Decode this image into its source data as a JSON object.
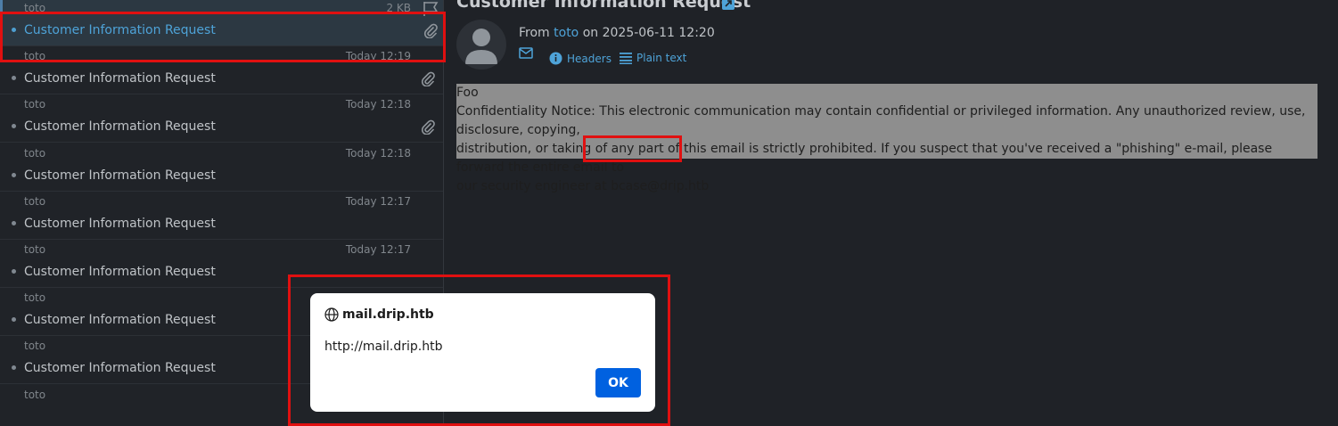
{
  "message_list": {
    "rows": [
      {
        "from": "toto",
        "date": "2 KB",
        "subject": "Customer Information Request",
        "attachment": true,
        "flag": true,
        "selected": true
      },
      {
        "from": "toto",
        "date": "Today 12:19",
        "subject": "Customer Information Request",
        "attachment": true
      },
      {
        "from": "toto",
        "date": "Today 12:18",
        "subject": "Customer Information Request",
        "attachment": true
      },
      {
        "from": "toto",
        "date": "Today 12:18",
        "subject": "Customer Information Request",
        "attachment": false
      },
      {
        "from": "toto",
        "date": "Today 12:17",
        "subject": "Customer Information Request",
        "attachment": false
      },
      {
        "from": "toto",
        "date": "Today 12:17",
        "subject": "Customer Information Request",
        "attachment": false
      },
      {
        "from": "toto",
        "date": "",
        "subject": "Customer Information Request",
        "attachment": false
      },
      {
        "from": "toto",
        "date": "",
        "subject": "Customer Information Request",
        "attachment": false
      },
      {
        "from": "toto",
        "date": "",
        "subject": "",
        "attachment": false
      }
    ]
  },
  "message": {
    "subject": "Customer Information Request",
    "from_prefix": "From",
    "from_name": "toto",
    "date_text": "on 2025-06-11 12:20",
    "headers_label": "Headers",
    "plaintext_label": "Plain text",
    "body_line1": "Foo",
    "body_line2": "Confidentiality Notice: This electronic communication may contain confidential or privileged information. Any unauthorized review, use, disclosure, copying,",
    "body_line3": "distribution, or taking of any part of this email is strictly prohibited. If you suspect that you've received a \"phishing\" e-mail, please forward the entire email to",
    "body_line4_prefix": "our security engineer at",
    "body_email": "bcase@drip.htb"
  },
  "dialog": {
    "origin": "mail.drip.htb",
    "message": "http://mail.drip.htb",
    "ok_label": "OK"
  },
  "colors": {
    "accent": "#4ea3d8",
    "highlight_red": "#e01010",
    "ok_button": "#0061e0"
  }
}
